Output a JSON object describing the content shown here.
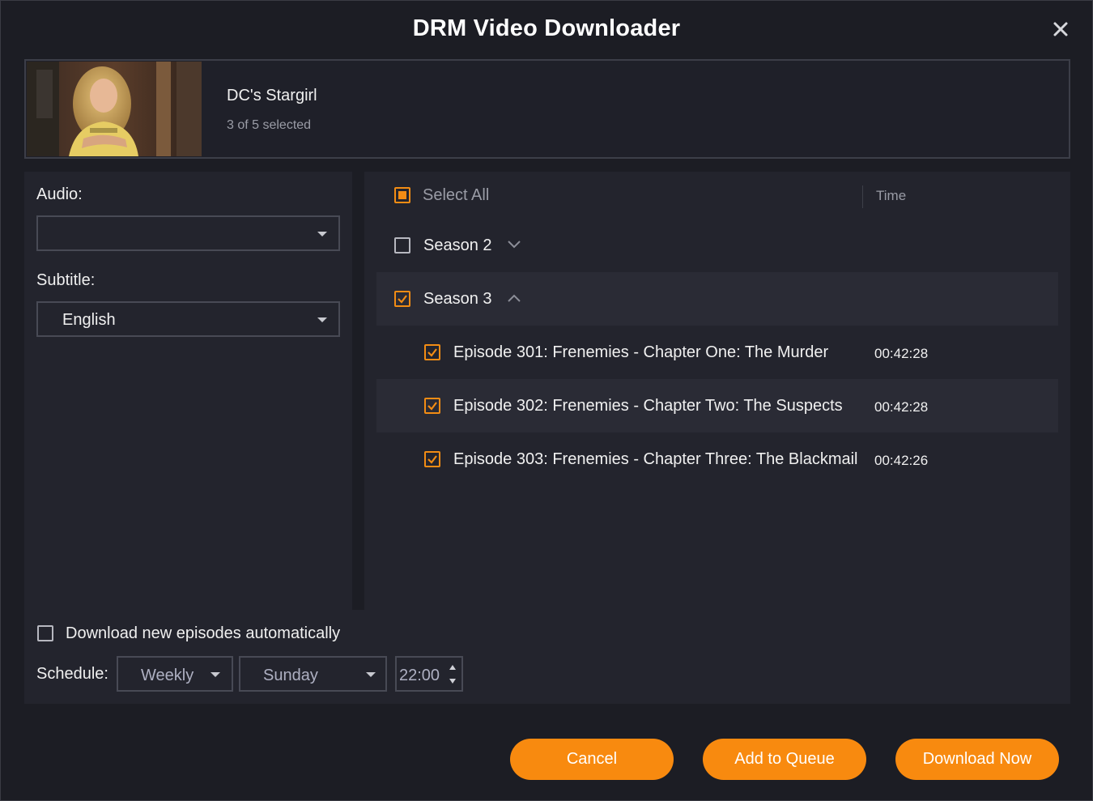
{
  "window": {
    "title": "DRM Video Downloader",
    "close_icon": "close-icon"
  },
  "show": {
    "title": "DC's Stargirl",
    "selection_count": "3 of 5 selected"
  },
  "options": {
    "audio_label": "Audio:",
    "audio_value": "",
    "subtitle_label": "Subtitle:",
    "subtitle_value": "English"
  },
  "episode_list": {
    "select_all_label": "Select All",
    "time_header": "Time",
    "seasons": [
      {
        "label": "Season 2",
        "checked": false,
        "expanded": false
      },
      {
        "label": "Season 3",
        "checked": true,
        "expanded": true
      }
    ],
    "episodes": [
      {
        "title": "Episode 301: Frenemies - Chapter One: The Murder",
        "time": "00:42:28",
        "checked": true
      },
      {
        "title": "Episode 302: Frenemies - Chapter Two: The Suspects",
        "time": "00:42:28",
        "checked": true
      },
      {
        "title": "Episode 303: Frenemies - Chapter Three: The Blackmail",
        "time": "00:42:26",
        "checked": true
      }
    ]
  },
  "auto_download": {
    "label": "Download new episodes automatically",
    "checked": false,
    "schedule_label": "Schedule:",
    "frequency": "Weekly",
    "day": "Sunday",
    "time": "22:00"
  },
  "buttons": {
    "cancel": "Cancel",
    "add_to_queue": "Add to Queue",
    "download_now": "Download Now"
  },
  "colors": {
    "accent": "#f88a0f",
    "background": "#1c1d24",
    "panel": "#23242d"
  }
}
